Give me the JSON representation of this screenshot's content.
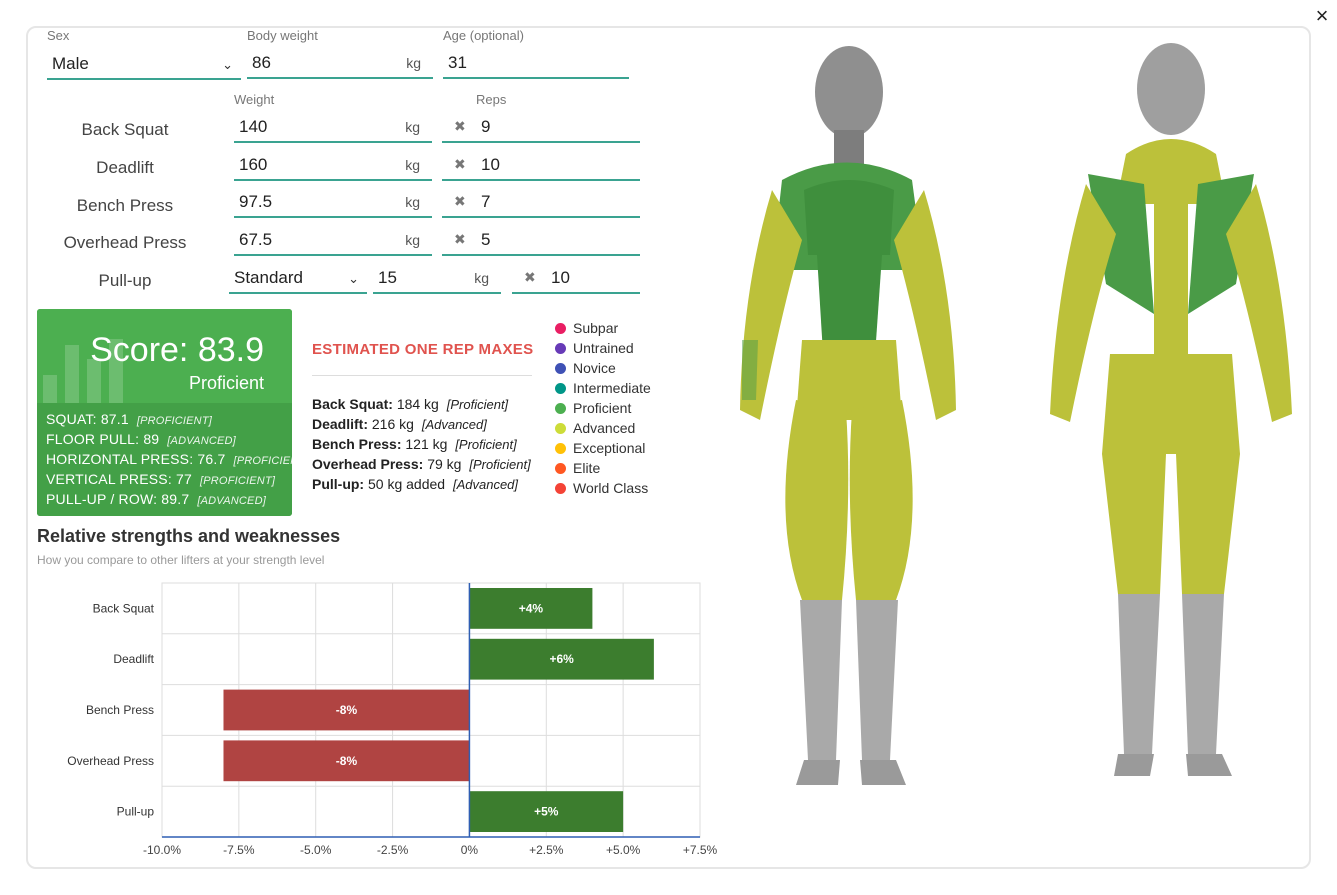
{
  "close_label": "×",
  "profile": {
    "sex_label": "Sex",
    "sex_value": "Male",
    "bodyweight_label": "Body weight",
    "bodyweight_value": "86",
    "bodyweight_unit": "kg",
    "age_label": "Age (optional)",
    "age_value": "31"
  },
  "lifts_header": {
    "weight_label": "Weight",
    "reps_label": "Reps"
  },
  "lifts": [
    {
      "name": "Back Squat",
      "weight": "140",
      "unit": "kg",
      "reps": "9"
    },
    {
      "name": "Deadlift",
      "weight": "160",
      "unit": "kg",
      "reps": "10"
    },
    {
      "name": "Bench Press",
      "weight": "97.5",
      "unit": "kg",
      "reps": "7"
    },
    {
      "name": "Overhead Press",
      "weight": "67.5",
      "unit": "kg",
      "reps": "5"
    }
  ],
  "pullup": {
    "name": "Pull-up",
    "variant": "Standard",
    "weight": "15",
    "unit": "kg",
    "reps": "10"
  },
  "score": {
    "title": "Score: 83.9",
    "level": "Proficient",
    "items": [
      {
        "label": "SQUAT: 87.1",
        "level": "[PROFICIENT]"
      },
      {
        "label": "FLOOR PULL: 89",
        "level": "[ADVANCED]"
      },
      {
        "label": "HORIZONTAL PRESS: 76.7",
        "level": "[PROFICIENT]"
      },
      {
        "label": "VERTICAL PRESS: 77",
        "level": "[PROFICIENT]"
      },
      {
        "label": "PULL-UP / ROW: 89.7",
        "level": "[ADVANCED]"
      }
    ]
  },
  "orm": {
    "title": "ESTIMATED ONE REP MAXES",
    "items": [
      {
        "lift": "Back Squat:",
        "value": "184 kg",
        "level": "[Proficient]"
      },
      {
        "lift": "Deadlift:",
        "value": "216 kg",
        "level": "[Advanced]"
      },
      {
        "lift": "Bench Press:",
        "value": "121 kg",
        "level": "[Proficient]"
      },
      {
        "lift": "Overhead Press:",
        "value": "79 kg",
        "level": "[Proficient]"
      },
      {
        "lift": "Pull-up:",
        "value": "50 kg added",
        "level": "[Advanced]"
      }
    ]
  },
  "legend": [
    {
      "label": "Subpar",
      "color": "#e91e63"
    },
    {
      "label": "Untrained",
      "color": "#673ab7"
    },
    {
      "label": "Novice",
      "color": "#3f51b5"
    },
    {
      "label": "Intermediate",
      "color": "#009688"
    },
    {
      "label": "Proficient",
      "color": "#4caf50"
    },
    {
      "label": "Advanced",
      "color": "#cddc39"
    },
    {
      "label": "Exceptional",
      "color": "#ffc107"
    },
    {
      "label": "Elite",
      "color": "#ff5722"
    },
    {
      "label": "World Class",
      "color": "#f44336"
    }
  ],
  "chart": {
    "title": "Relative strengths and weaknesses",
    "subtitle": "How you compare to other lifters at your strength level"
  },
  "chart_data": {
    "type": "bar",
    "orientation": "horizontal",
    "categories": [
      "Back Squat",
      "Deadlift",
      "Bench Press",
      "Overhead Press",
      "Pull-up"
    ],
    "values": [
      4,
      6,
      -8,
      -8,
      5
    ],
    "labels": [
      "+4%",
      "+6%",
      "-8%",
      "-8%",
      "+5%"
    ],
    "xlim": [
      -10,
      7.5
    ],
    "xticks": [
      -10,
      -7.5,
      -5,
      -2.5,
      0,
      2.5,
      5,
      7.5
    ],
    "xtick_labels": [
      "-10.0%",
      "-7.5%",
      "-5.0%",
      "-2.5%",
      "0%",
      "+2.5%",
      "+5.0%",
      "+7.5%"
    ],
    "positive_color": "#3c7d2e",
    "negative_color": "#b04442",
    "grid": true
  },
  "muscle_colors": {
    "proficient": "#4a9b47",
    "advanced": "#bcc13a",
    "neutral": "#9a9a9a"
  }
}
